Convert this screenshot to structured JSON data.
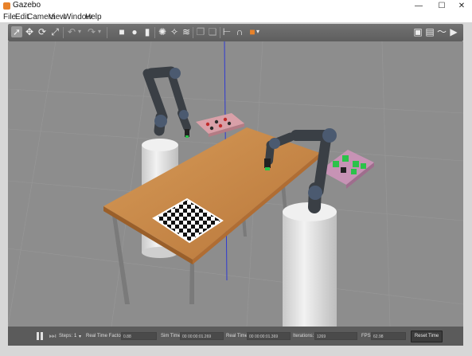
{
  "window": {
    "title": "Gazebo",
    "minimize": "—",
    "maximize": "☐",
    "close": "✕"
  },
  "menu": [
    "File",
    "Edit",
    "Camera",
    "View",
    "Window",
    "Help"
  ],
  "toolbar": {
    "left_icons": [
      "select-arrow-icon",
      "translate-icon",
      "rotate-icon",
      "scale-icon",
      "undo-icon",
      "undo-dropdown-icon",
      "redo-icon",
      "redo-dropdown-icon",
      "box-icon",
      "sphere-icon",
      "cylinder-icon",
      "sun-light-icon",
      "spot-light-icon",
      "directional-light-icon",
      "copy-icon",
      "paste-icon",
      "align-icon",
      "snap-icon",
      "color-icon"
    ],
    "right_icons": [
      "screenshot-icon",
      "log-icon",
      "plot-icon",
      "video-icon"
    ]
  },
  "bottom": {
    "steps_label": "Steps:",
    "steps_value": "1",
    "rtf_label": "Real Time Factor:",
    "rtf_value": "0.88",
    "sim_time_label": "Sim Time:",
    "sim_time_value": "00 00:00:01.269",
    "real_time_label": "Real Time:",
    "real_time_value": "00 00:00:01.369",
    "iterations_label": "Iterations:",
    "iterations_value": "1269",
    "fps_label": "FPS:",
    "fps_value": "62.98",
    "reset_label": "Reset Time"
  },
  "colors": {
    "viewport_bg": "#8d8d8d",
    "table_wood": "#c98a47",
    "robot_dark": "#3a3f45",
    "robot_cap": "#4b5a70",
    "pedestal": "#e8e8e8",
    "tray_pink": "#d9a0a8",
    "axis_blue": "#2f3ad1",
    "axis_red": "#c83030"
  }
}
